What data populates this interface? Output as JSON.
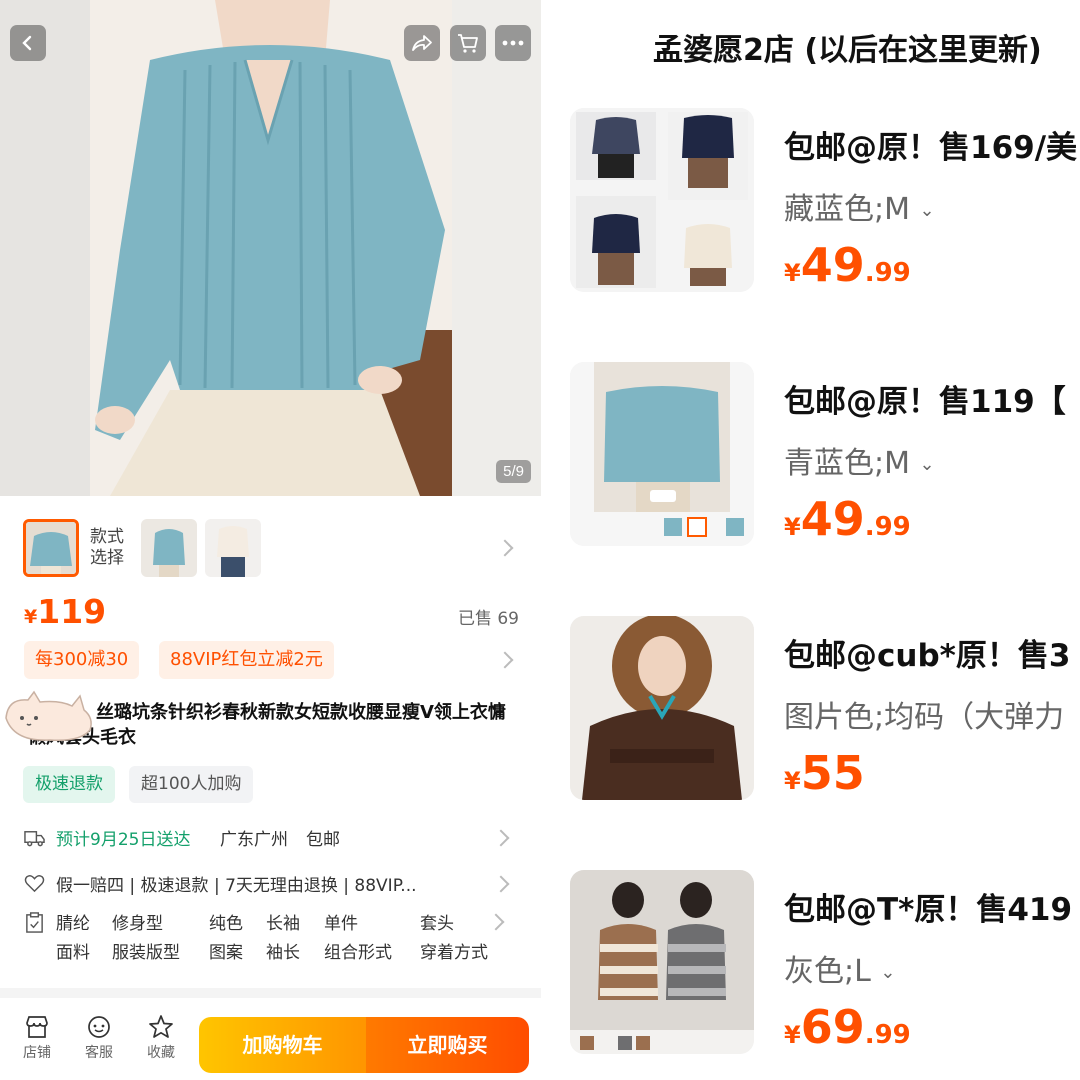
{
  "left": {
    "image_counter": "5/9",
    "style_selector": {
      "label": "款式选择"
    },
    "price": {
      "currency": "¥",
      "amount": "119"
    },
    "sold": "已售 69",
    "promos": [
      "每300减30",
      "88VIP红包立减2元"
    ],
    "title": "丝璐坑条针织衫春秋新款女短款收腰显瘦V领上衣慵懒风套头毛衣",
    "tags": [
      "极速退款",
      "超100人加购"
    ],
    "shipping": {
      "eta": "预计9月25日送达",
      "origin": "广东广州",
      "fee": "包邮"
    },
    "guarantees": "假一赔四 | 极速退款 | 7天无理由退换 | 88VIP...",
    "properties": [
      {
        "value": "腈纶",
        "name": "面料"
      },
      {
        "value": "修身型",
        "name": "服装版型"
      },
      {
        "value": "纯色",
        "name": "图案"
      },
      {
        "value": "长袖",
        "name": "袖长"
      },
      {
        "value": "单件",
        "name": "组合形式"
      },
      {
        "value": "套头",
        "name": "穿着方式"
      }
    ],
    "bottom_nav": [
      {
        "label": "店铺",
        "icon": "shop-icon"
      },
      {
        "label": "客服",
        "icon": "customer-service-icon"
      },
      {
        "label": "收藏",
        "icon": "star-icon"
      }
    ],
    "add_to_cart": "加购物车",
    "buy_now": "立即购买",
    "accent_color": "#ff5000"
  },
  "right": {
    "shop_title": "孟婆愿2店 (以后在这里更新)",
    "items": [
      {
        "title": "包邮@原！售169/美",
        "spec": "藏蓝色;M",
        "price_yen": "¥",
        "price_int": "49",
        "price_dec": ".99"
      },
      {
        "title": "包邮@原！售119【",
        "spec": "青蓝色;M",
        "price_yen": "¥",
        "price_int": "49",
        "price_dec": ".99"
      },
      {
        "title": "包邮@cub*原！售3",
        "spec": "图片色;均码（大弹力",
        "price_yen": "¥",
        "price_int": "55",
        "price_dec": ""
      },
      {
        "title": "包邮@T*原！售419",
        "spec": "灰色;L",
        "price_yen": "¥",
        "price_int": "69",
        "price_dec": ".99"
      }
    ]
  }
}
